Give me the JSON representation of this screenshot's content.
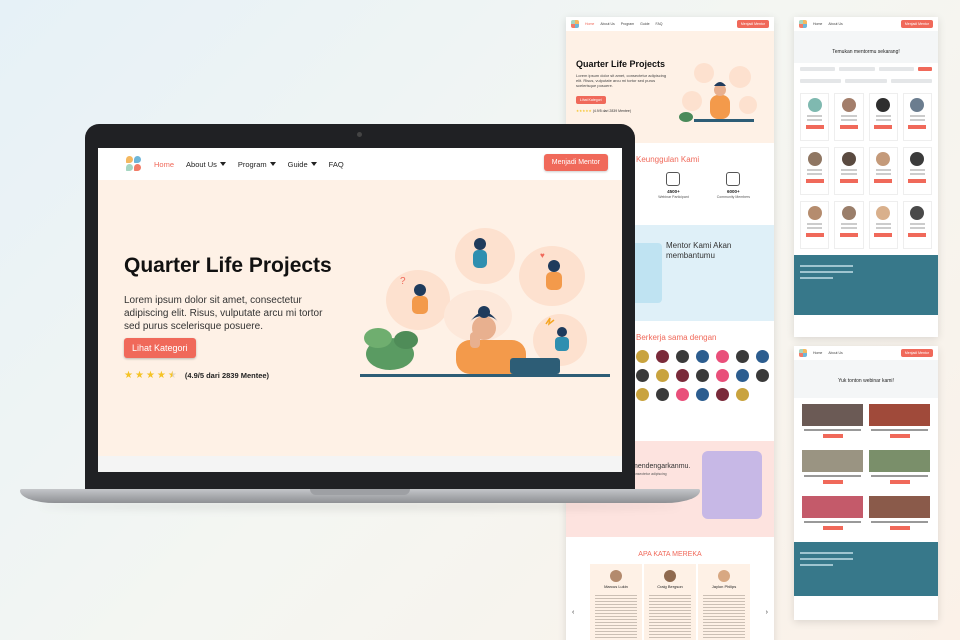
{
  "landing": {
    "nav": {
      "items": [
        {
          "label": "Home",
          "active": true
        },
        {
          "label": "About Us",
          "caret": true
        },
        {
          "label": "Program",
          "caret": true
        },
        {
          "label": "Guide",
          "caret": true
        },
        {
          "label": "FAQ"
        }
      ],
      "cta": "Menjadi Mentor"
    },
    "hero": {
      "title": "Quarter Life Projects",
      "body": "Lorem ipsum dolor sit amet, consectetur adipiscing elit. Risus, vulputate arcu mi tortor sed purus scelerisque posuere.",
      "cta": "Lihat Kategori",
      "rating_stars": 4.5,
      "rating_text": "(4.9/5 dari 2839 Mentee)"
    },
    "sections": {
      "keunggulan": "Keunggulan Kami",
      "stats": [
        {
          "value": "2000+",
          "label": "Ajuran Certiz"
        },
        {
          "value": "4500+",
          "label": "Webinar Participant"
        },
        {
          "value": "6000+",
          "label": "Community Members"
        }
      ],
      "mentor_title": "Mentor Kami Akan membantumu",
      "partner_title": "Berkerja sama dengan",
      "dengar_title": "mendengarkanmu.",
      "dengar_sub": "consectetur adipiscing",
      "testi_title": "APA KATA MEREKA",
      "testimonials": [
        "Marcus Lukin",
        "Craig Bergson",
        "Jaylon Philips"
      ],
      "arrow_left": "‹",
      "arrow_right": "›"
    }
  },
  "mentors_page": {
    "title": "Temukan mentormu sekarang!"
  },
  "webinar_page": {
    "title": "Yuk tonton webinar kami!"
  },
  "colors": {
    "accent": "#f0695a",
    "hero_bg": "#fef1e6",
    "mentor_bg": "#dff0f8",
    "footer_teal": "#37788a"
  }
}
